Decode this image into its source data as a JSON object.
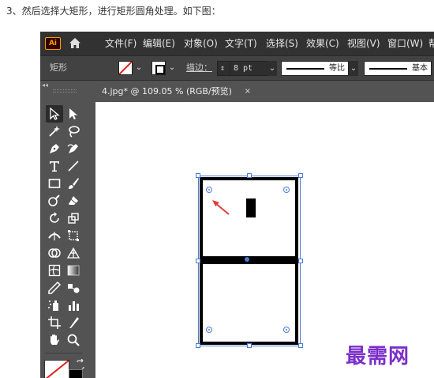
{
  "caption": "3、然后选择大矩形，进行矩形圆角处理。如下图：",
  "app": {
    "logo": "Ai",
    "menu": [
      "文件(F)",
      "编辑(E)",
      "对象(O)",
      "文字(T)",
      "选择(S)",
      "效果(C)",
      "视图(V)",
      "窗口(W)",
      "帮"
    ]
  },
  "controlbar": {
    "selection_label": "矩形",
    "stroke_label": "描边：",
    "stroke_value": "8 pt",
    "profile_label": "等比",
    "brush_label": "基本"
  },
  "document": {
    "tab_title": "4.jpg* @ 109.05 % (RGB/预览)",
    "tab_close": "×"
  },
  "watermark": "最需网",
  "colors": {
    "accent_selection": "#4b7bd6",
    "arrow_red": "#e23b3b",
    "watermark": "#7b2fc9",
    "logo_orange": "#ff9a00"
  },
  "icons": [
    "home-icon",
    "selection-tool-icon",
    "direct-selection-tool-icon",
    "magic-wand-tool-icon",
    "lasso-tool-icon",
    "pen-tool-icon",
    "curvature-tool-icon",
    "type-tool-icon",
    "line-segment-tool-icon",
    "rectangle-tool-icon",
    "paintbrush-tool-icon",
    "shaper-tool-icon",
    "eraser-tool-icon",
    "rotate-tool-icon",
    "scale-tool-icon",
    "width-tool-icon",
    "free-transform-tool-icon",
    "shape-builder-tool-icon",
    "perspective-grid-tool-icon",
    "mesh-tool-icon",
    "gradient-tool-icon",
    "eyedropper-tool-icon",
    "blend-tool-icon",
    "symbol-sprayer-tool-icon",
    "column-graph-tool-icon",
    "artboard-tool-icon",
    "slice-tool-icon",
    "hand-tool-icon",
    "zoom-tool-icon",
    "swap-fill-stroke-icon"
  ]
}
